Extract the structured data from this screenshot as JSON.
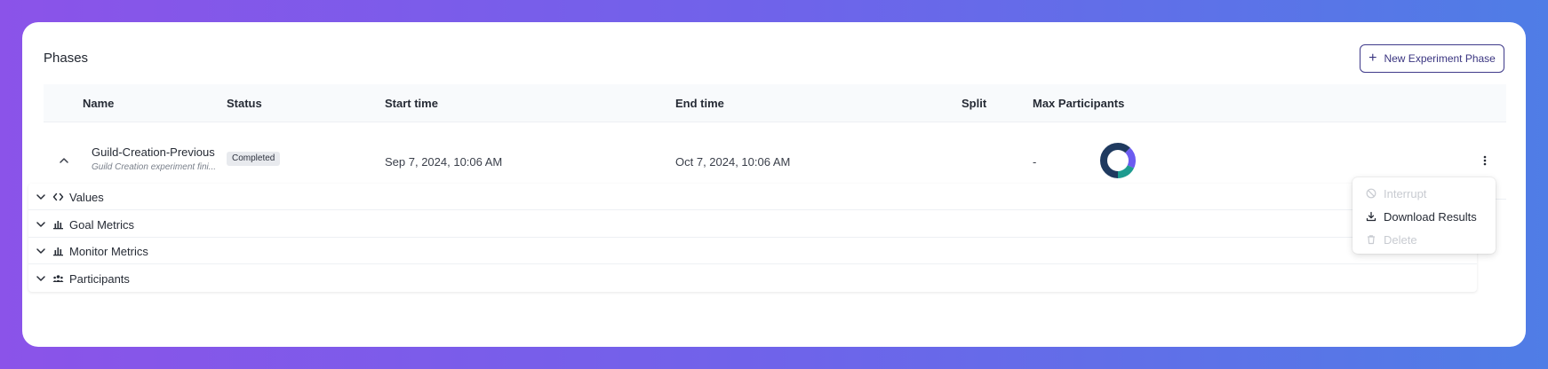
{
  "card": {
    "title": "Phases",
    "new_phase_button": "New Experiment Phase"
  },
  "table": {
    "headers": [
      "Name",
      "Status",
      "Start time",
      "End time",
      "Split",
      "Max Participants"
    ],
    "rows": [
      {
        "name": "Guild-Creation-Previous",
        "description": "Guild Creation experiment fini...",
        "status": "Completed",
        "start_time": "Sep 7, 2024, 10:06 AM",
        "end_time": "Oct 7, 2024, 10:06 AM",
        "max_participants": "-",
        "split": [
          {
            "share": 0.62,
            "color": "#1f3a5f"
          },
          {
            "share": 0.2,
            "color": "#6b5bf0"
          },
          {
            "share": 0.18,
            "color": "#1d9b8f"
          }
        ]
      }
    ]
  },
  "sections": [
    {
      "label": "Values",
      "icon": "code-icon"
    },
    {
      "label": "Goal Metrics",
      "icon": "bar-chart-icon"
    },
    {
      "label": "Monitor Metrics",
      "icon": "bar-chart-icon"
    },
    {
      "label": "Participants",
      "icon": "people-icon"
    }
  ],
  "menu": [
    {
      "label": "Interrupt",
      "icon": "block-icon",
      "disabled": true
    },
    {
      "label": "Download Results",
      "icon": "download-icon",
      "disabled": false
    },
    {
      "label": "Delete",
      "icon": "trash-icon",
      "disabled": true
    }
  ],
  "colors": {
    "accent": "#3a3580",
    "badge_bg": "#e8eaee",
    "disabled_text": "#c8cbd1"
  }
}
